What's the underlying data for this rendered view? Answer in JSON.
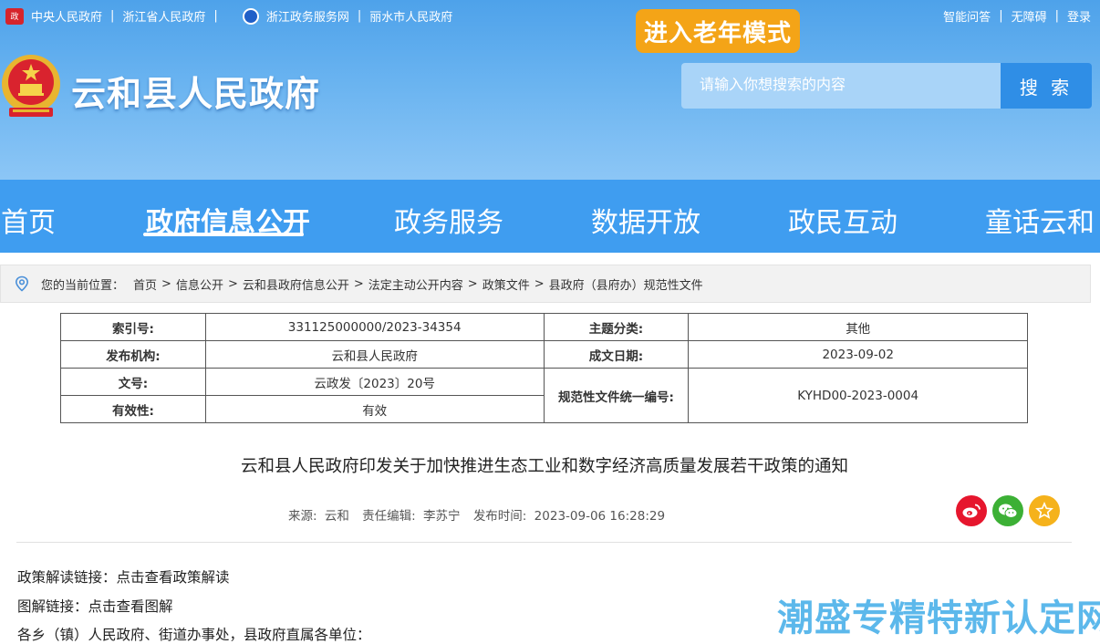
{
  "toplinks": {
    "left": [
      "中央人民政府",
      "浙江省人民政府",
      "浙江政务服务网",
      "丽水市人民政府"
    ],
    "right": [
      "智能问答",
      "无障碍",
      "登录"
    ],
    "sep": "|"
  },
  "elder_mode": "进入老年模式",
  "site_title": "云和县人民政府",
  "search": {
    "placeholder": "请输入你想搜索的内容",
    "button": "搜 索"
  },
  "nav": [
    "首页",
    "政府信息公开",
    "政务服务",
    "数据开放",
    "政民互动",
    "童话云和"
  ],
  "breadcrumb": {
    "prefix": "您的当前位置：",
    "items": [
      "首页",
      "信息公开",
      "云和县政府信息公开",
      "法定主动公开内容",
      "政策文件",
      "县政府（县府办）规范性文件"
    ],
    "sep": ">"
  },
  "meta": {
    "index_label": "索引号:",
    "index_value": "331125000000/2023-34354",
    "topic_label": "主题分类:",
    "topic_value": "其他",
    "org_label": "发布机构:",
    "org_value": "云和县人民政府",
    "date_label": "成文日期:",
    "date_value": "2023-09-02",
    "docno_label": "文号:",
    "docno_value": "云政发〔2023〕20号",
    "code_label": "规范性文件统一编号:",
    "code_value": "KYHD00-2023-0004",
    "valid_label": "有效性:",
    "valid_value": "有效"
  },
  "doc": {
    "title": "云和县人民政府印发关于加快推进生态工业和数字经济高质量发展若干政策的通知",
    "source_label": "来源:",
    "source": "云和",
    "editor_label": "责任编辑:",
    "editor": "李苏宁",
    "time_label": "发布时间:",
    "time": "2023-09-06 16:28:29"
  },
  "body": {
    "line1_label": "政策解读链接：",
    "line1_link": "点击查看政策解读",
    "line2_label": "图解链接：",
    "line2_link": "点击查看图解",
    "line3": "各乡（镇）人民政府、街道办事处，县政府直属各单位："
  },
  "share_icons": [
    "weibo-icon",
    "wechat-icon",
    "star-icon"
  ],
  "watermark": "潮盛专精特新认定网",
  "colors": {
    "header": "#4ea2ea",
    "nav": "#3f9df0",
    "elder": "#f4a417",
    "weibo": "#e6162d",
    "wechat": "#3cb035",
    "star": "#f5b21b"
  }
}
